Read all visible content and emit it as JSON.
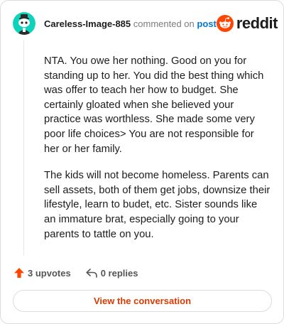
{
  "header": {
    "username": "Careless-Image-885",
    "commented_on": "commented on",
    "post_link": "post",
    "brand_name": "reddit",
    "avatar_icon": "snoo-avatar-icon",
    "brand_icon": "reddit-logo-icon"
  },
  "comment": {
    "paragraphs": [
      "NTA. You owe her nothing. Good on you for standing up to her. You did the best thing which was offer to teach her how to budget. She certainly gloated when she believed your practice was worthless. She made some very poor life choices> You are not responsible for her or her family.",
      "The kids will not become homeless. Parents can sell assets, both of them get jobs, downsize their lifestyle, learn to budet, etc. Sister sounds like an immature brat, especially going to your parents to tattle on you."
    ]
  },
  "actions": {
    "upvotes": "3 upvotes",
    "replies": "0 replies",
    "upvote_icon": "upvote-arrow-icon",
    "reply_icon": "reply-arrow-icon"
  },
  "cta": {
    "label": "View the conversation"
  },
  "colors": {
    "brand": "#ff4500",
    "link": "#0079d3",
    "cta_text": "#d93a00",
    "avatar_bg": "#0dd3bb"
  }
}
